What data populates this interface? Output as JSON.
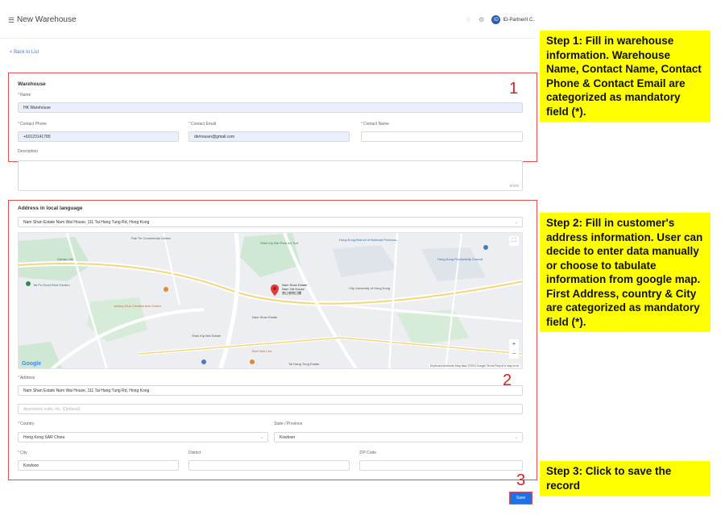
{
  "header": {
    "menu_icon": "menu-icon",
    "title": "New Warehouse",
    "bell_icon": "bell-icon",
    "settings_icon": "gear-icon",
    "user": "ID-PartnerII C.."
  },
  "back_link": "< Back to List",
  "warehouse": {
    "section_title": "Warehouse",
    "name_label": "Name",
    "name_value": "HK Warehouse",
    "phone_label": "Contact Phone",
    "phone_value": "+60123141789",
    "email_label": "Contact Email",
    "email_value": "demouser@gmail.com",
    "contact_name_label": "Contact Name",
    "contact_name_value": "",
    "description_label": "Description",
    "description_count": "0/200"
  },
  "address": {
    "section_title": "Address in local language",
    "search_value": "Nam Shan Estate Nam Wai House, 111 Tai Hang Tung Rd, Hong Kong",
    "address_label": "Address",
    "address_value": "Nam Shan Estate Nam Wai House, 111 Tai Hang Tung Rd, Hong Kong",
    "address2_placeholder": "Apartment, suite, etc. (Optional)",
    "country_label": "Country",
    "country_value": "Hong Kong SAR China",
    "state_label": "State / Province",
    "state_value": "Kowloon",
    "city_label": "City",
    "city_value": "Kowloon",
    "district_label": "District",
    "district_value": "",
    "zip_label": "ZIP Code",
    "zip_value": ""
  },
  "map": {
    "pin_label_1": "Nam Shan Estate",
    "pin_label_2": "Nam Yat House",
    "pin_label_3": "南山邨南日樓",
    "poi_park": "Shek Kip Mei Park Art Turf",
    "poi_garden": "Garden Hill",
    "poi_taipo": "Tai Po Road Rest Garden",
    "poi_center": "Pak Tin Commercial Centre",
    "poi_jockey": "Jockey Club Creative Arts Centre",
    "poi_cityu": "City University of Hong Kong",
    "poi_nam_shan": "Nam Shan Estate",
    "poi_bank": "Hong Kong Branch of National Precious...",
    "poi_baptist": "Hong Kong Productivity Council",
    "poi_shek_kip": "Shek Kip Mei Estate",
    "poi_bun_bakery": "Bun Hsiu Lau",
    "poi_road": "Tai Hang Tung Estate",
    "google": "Google",
    "attribution": "Keyboard shortcuts   Map data ©2024 Google   Terms   Report a map error"
  },
  "annotations": {
    "num1": "1",
    "num2": "2",
    "num3": "3",
    "step1": "Step 1: Fill in warehouse information. Warehouse Name, Contact Name, Contact Phone & Contact Email are categorized as mandatory field (*).",
    "step2": "Step 2: Fill in customer's address information. User can decide to enter data manually or choose to tabulate information from google map. First Address, country & City are categorized as mandatory field (*).",
    "step3": "Step 3: Click to save the record"
  },
  "save_label": "Save",
  "required_mark": "*",
  "chevron": "⌄",
  "colors": {
    "accent": "#1a73e8",
    "annotation_red": "#e02020",
    "highlight_yellow": "#ffff00",
    "filled_field": "#e9effb"
  }
}
